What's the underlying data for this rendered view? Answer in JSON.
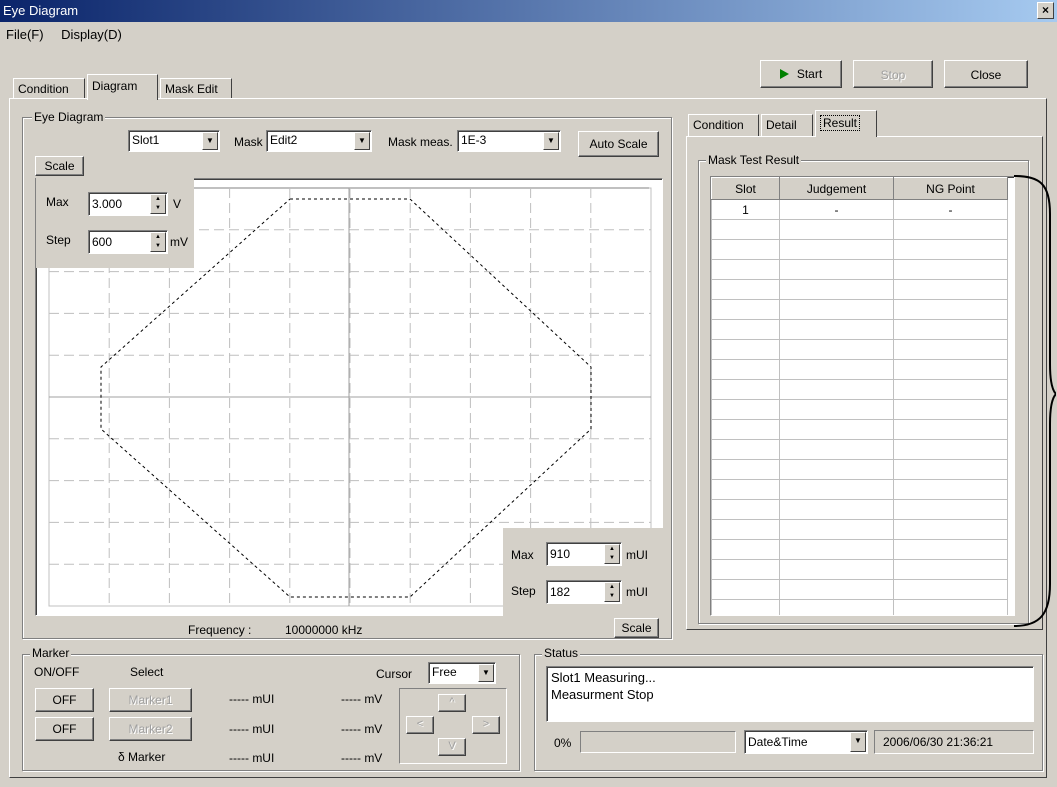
{
  "window": {
    "title": "Eye Diagram",
    "close_glyph": "×"
  },
  "menu": [
    "File(F)",
    "Display(D)"
  ],
  "toolbar": {
    "start_label": "Start",
    "stop_label": "Stop",
    "close_label": "Close"
  },
  "main_tabs": [
    "Condition",
    "Diagram",
    "Mask Edit"
  ],
  "eye_diagram": {
    "group_label": "Eye Diagram",
    "slot_value": "Slot1",
    "mask_label": "Mask",
    "mask_value": "Edit2",
    "mask_meas_label": "Mask meas.",
    "mask_meas_value": "1E-3",
    "auto_scale_label": "Auto Scale",
    "scale_button_label": "Scale",
    "y_scale": {
      "max_label": "Max",
      "max_value": "3.000",
      "max_unit": "V",
      "step_label": "Step",
      "step_value": "600",
      "step_unit": "mV"
    },
    "x_scale": {
      "max_label": "Max",
      "max_value": "910",
      "max_unit": "mUI",
      "step_label": "Step",
      "step_value": "182",
      "step_unit": "mUI"
    },
    "x_scale_button_label": "Scale",
    "frequency_label": "Frequency :",
    "frequency_value": "10000000 kHz"
  },
  "right_tabs": [
    "Condition",
    "Detail",
    "Result"
  ],
  "mask_result": {
    "group_label": "Mask Test Result",
    "columns": [
      "Slot",
      "Judgement",
      "NG Point"
    ],
    "rows": [
      [
        "1",
        "-",
        "-"
      ]
    ]
  },
  "marker": {
    "group_label": "Marker",
    "onoff_label": "ON/OFF",
    "select_label": "Select",
    "off1_label": "OFF",
    "off2_label": "OFF",
    "marker1_label": "Marker1",
    "marker2_label": "Marker2",
    "delta_label": "δ Marker",
    "cursor_label": "Cursor",
    "cursor_value": "Free",
    "readouts": [
      {
        "ui": "----- mUI",
        "mv": "----- mV"
      },
      {
        "ui": "----- mUI",
        "mv": "----- mV"
      },
      {
        "ui": "----- mUI",
        "mv": "----- mV"
      }
    ],
    "arrows": {
      "up": "^",
      "left": "<",
      "right": ">",
      "down": "V"
    }
  },
  "status": {
    "group_label": "Status",
    "lines": [
      "Slot1 Measuring...",
      "Measurment Stop"
    ],
    "progress_text": "0%",
    "progress_fraction": 0,
    "datetime_mode": "Date&Time",
    "datetime_value": "2006/06/30 21:36:21"
  },
  "colors": {
    "face": "#d4d0c8",
    "title_start": "#0a246a",
    "title_end": "#a6caf0",
    "play_icon": "#008000"
  }
}
